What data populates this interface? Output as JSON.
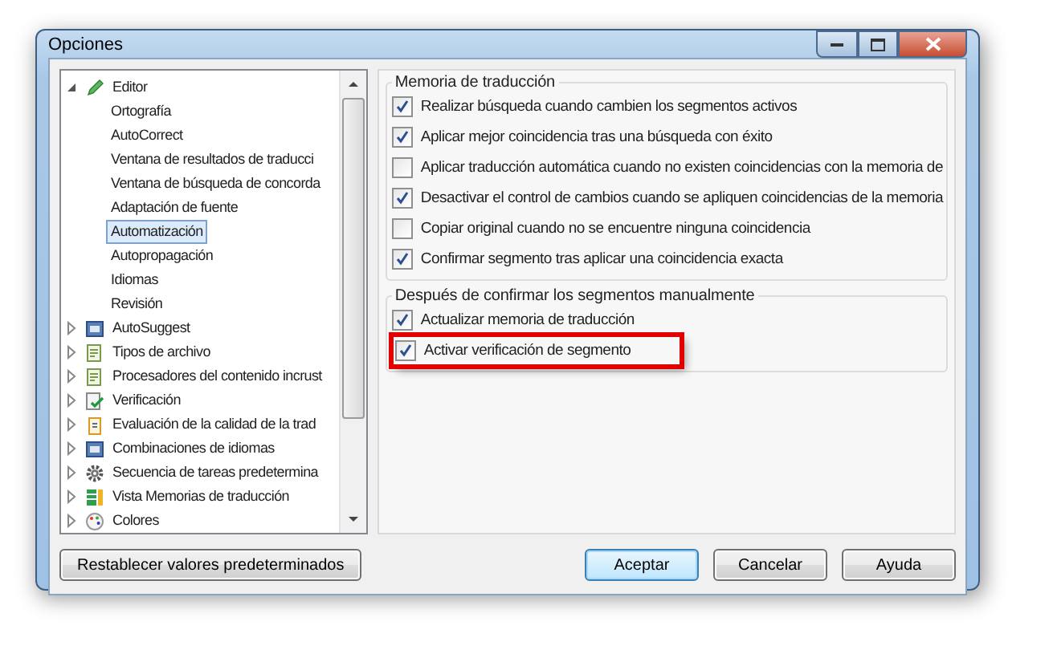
{
  "window": {
    "title": "Opciones"
  },
  "tree": [
    {
      "label": "Editor",
      "kind": "pencil",
      "expanded": true,
      "selected": false,
      "children": [
        {
          "label": "Ortografía",
          "selected": false
        },
        {
          "label": "AutoCorrect",
          "selected": false
        },
        {
          "label": "Ventana de resultados de traducci",
          "selected": false
        },
        {
          "label": "Ventana de búsqueda de concorda",
          "selected": false
        },
        {
          "label": "Adaptación de fuente",
          "selected": false
        },
        {
          "label": "Automatización",
          "selected": true
        },
        {
          "label": "Autopropagación",
          "selected": false
        },
        {
          "label": "Idiomas",
          "selected": false
        },
        {
          "label": "Revisión",
          "selected": false
        }
      ]
    },
    {
      "label": "AutoSuggest",
      "kind": "box",
      "expanded": false,
      "selected": false
    },
    {
      "label": "Tipos de archivo",
      "kind": "document",
      "expanded": false,
      "selected": false
    },
    {
      "label": "Procesadores del contenido incrust",
      "kind": "document",
      "expanded": false,
      "selected": false
    },
    {
      "label": "Verificación",
      "kind": "check",
      "expanded": false,
      "selected": false
    },
    {
      "label": "Evaluación de la calidad de la trad",
      "kind": "clipboard",
      "expanded": false,
      "selected": false
    },
    {
      "label": "Combinaciones de idiomas",
      "kind": "box",
      "expanded": false,
      "selected": false
    },
    {
      "label": "Secuencia de tareas predetermina",
      "kind": "gear",
      "expanded": false,
      "selected": false
    },
    {
      "label": "Vista Memorias de traducción",
      "kind": "grid",
      "expanded": false,
      "selected": false
    },
    {
      "label": "Colores",
      "kind": "palette",
      "expanded": false,
      "selected": false
    }
  ],
  "groups": [
    {
      "title": "Memoria de traducción",
      "options": [
        {
          "label": "Realizar búsqueda cuando cambien los segmentos activos",
          "checked": true,
          "highlighted": false
        },
        {
          "label": "Aplicar mejor coincidencia tras una búsqueda con éxito",
          "checked": true,
          "highlighted": false
        },
        {
          "label": "Aplicar traducción automática cuando no existen coincidencias con la memoria de",
          "checked": false,
          "highlighted": false
        },
        {
          "label": "Desactivar el control de cambios cuando se apliquen coincidencias de la memoria",
          "checked": true,
          "highlighted": false
        },
        {
          "label": "Copiar original cuando no se encuentre ninguna coincidencia",
          "checked": false,
          "highlighted": false
        },
        {
          "label": "Confirmar segmento tras aplicar una coincidencia exacta",
          "checked": true,
          "highlighted": false
        }
      ]
    },
    {
      "title": "Después de confirmar los segmentos manualmente",
      "options": [
        {
          "label": "Actualizar memoria de traducción",
          "checked": true,
          "highlighted": false
        },
        {
          "label": "Activar verificación de segmento",
          "checked": true,
          "highlighted": true
        }
      ]
    }
  ],
  "reset_button": "Restablecer valores predeterminados",
  "buttons": [
    {
      "label": "Aceptar",
      "default": true
    },
    {
      "label": "Cancelar",
      "default": false
    },
    {
      "label": "Ayuda",
      "default": false
    }
  ]
}
